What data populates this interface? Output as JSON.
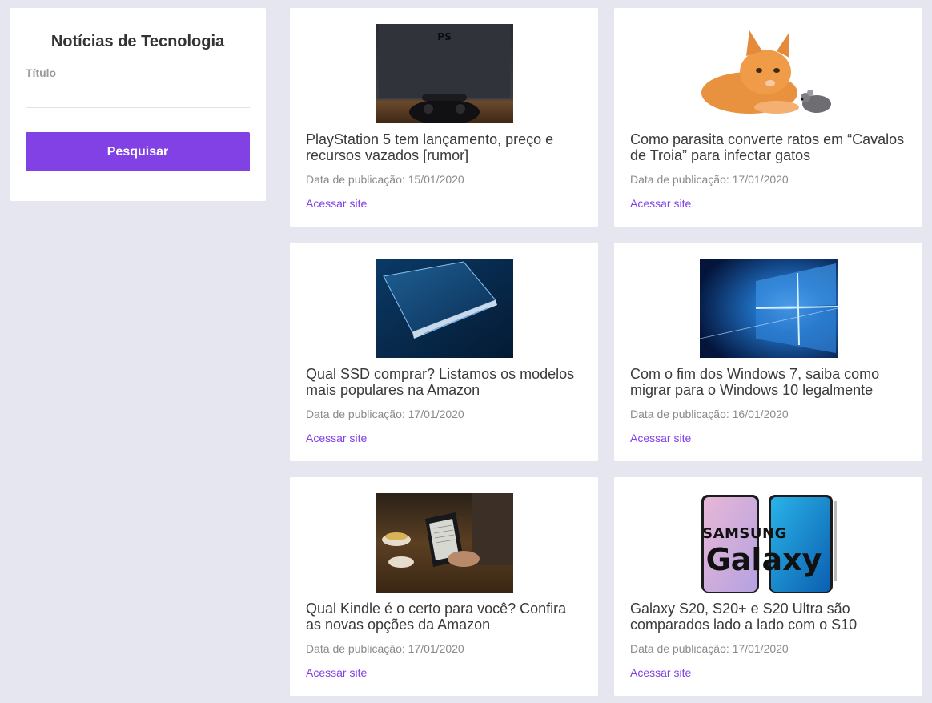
{
  "sidebar": {
    "title": "Notícias de Tecnologia",
    "field_label": "Título",
    "field_value": "",
    "search_label": "Pesquisar"
  },
  "colors": {
    "accent": "#8141e5",
    "background": "#e6e6f0",
    "card": "#ffffff"
  },
  "cards": [
    {
      "image": "playstation-console-image",
      "title": "PlayStation 5 tem lançamento, preço e recursos vazados [rumor]",
      "date": "Data de publicação: 15/01/2020",
      "link": "Acessar site"
    },
    {
      "image": "cat-and-mouse-image",
      "title": "Como parasita converte ratos em “Cavalos de Troia” para infectar gatos",
      "date": "Data de publicação: 17/01/2020",
      "link": "Acessar site"
    },
    {
      "image": "ssd-drive-image",
      "title": "Qual SSD comprar? Listamos os modelos mais populares na Amazon",
      "date": "Data de publicação: 17/01/2020",
      "link": "Acessar site"
    },
    {
      "image": "windows-logo-image",
      "title": "Com o fim dos Windows 7, saiba como migrar para o Windows 10 legalmente",
      "date": "Data de publicação: 16/01/2020",
      "link": "Acessar site"
    },
    {
      "image": "kindle-reader-image",
      "title": "Qual Kindle é o certo para você? Confira as novas opções da Amazon",
      "date": "Data de publicação: 17/01/2020",
      "link": "Acessar site"
    },
    {
      "image": "samsung-galaxy-image",
      "image_text_top": "SAMSUNG",
      "image_text_bottom": "Galaxy",
      "title": "Galaxy S20, S20+ e S20 Ultra são comparados lado a lado com o S10",
      "date": "Data de publicação: 17/01/2020",
      "link": "Acessar site"
    }
  ]
}
